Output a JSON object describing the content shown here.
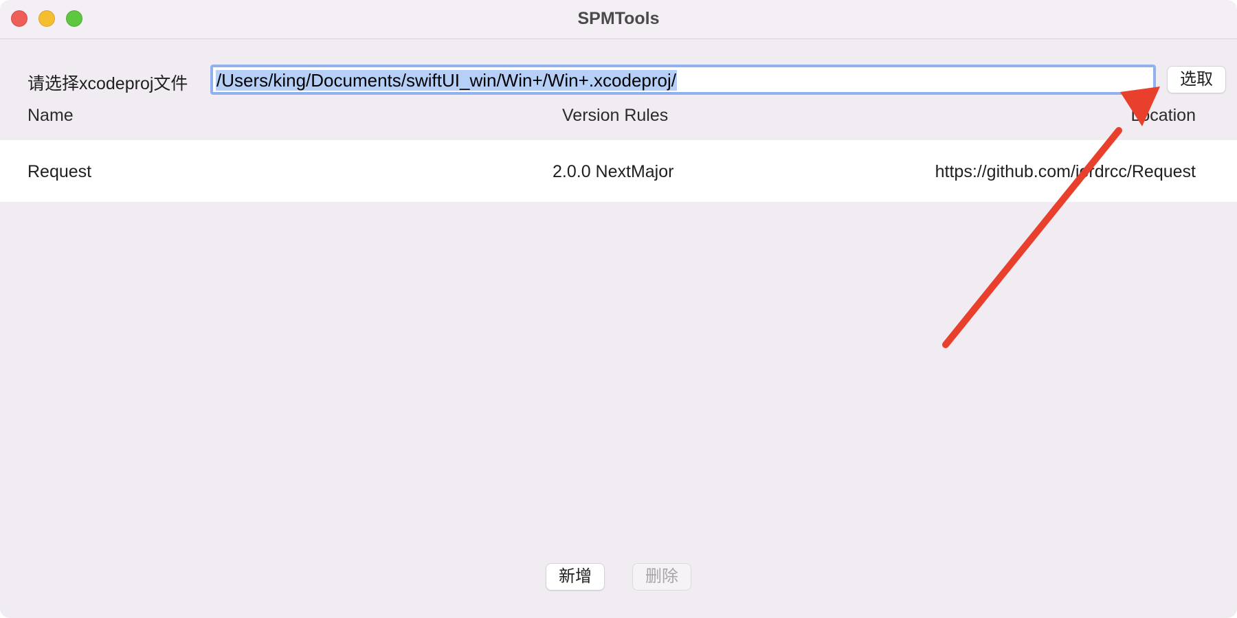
{
  "window": {
    "title": "SPMTools"
  },
  "path_selector": {
    "label": "请选择xcodeproj文件",
    "value": "/Users/king/Documents/swiftUI_win/Win+/Win+.xcodeproj/",
    "choose_label": "选取"
  },
  "table": {
    "headers": {
      "name": "Name",
      "version": "Version Rules",
      "location": "Location"
    },
    "rows": [
      {
        "name": "Request",
        "version": "2.0.0 NextMajor",
        "location": "https://github.com/jordrcc/Request"
      }
    ]
  },
  "actions": {
    "add_label": "新增",
    "delete_label": "删除"
  },
  "colors": {
    "annotation_arrow": "#e8402d",
    "selection": "#b6cff7",
    "focus_ring": "#8fb2ef"
  }
}
